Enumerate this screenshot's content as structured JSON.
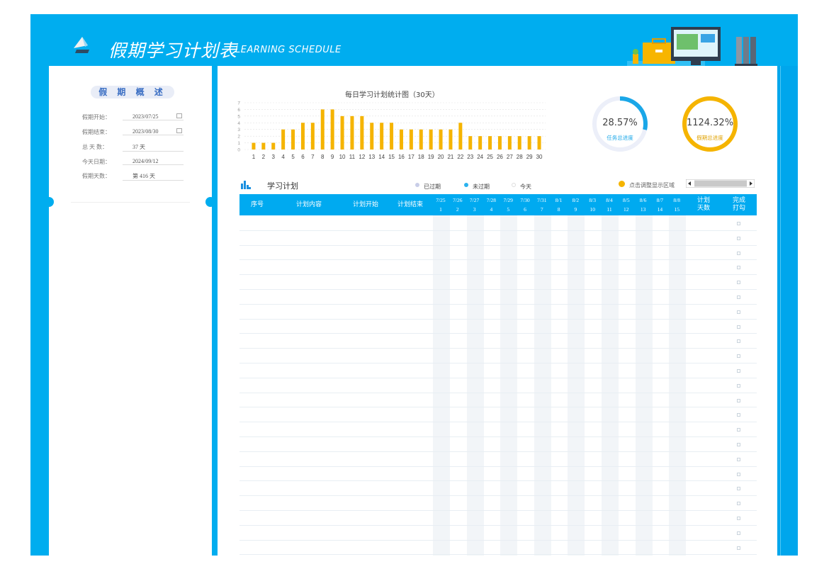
{
  "header": {
    "title": "假期学习计划表",
    "subtitle": "LEARNING SCHEDULE",
    "colors": {
      "frame": "#00adef",
      "accent_yellow": "#f5b400"
    }
  },
  "summary": {
    "section_title": "假 期 概 述",
    "fields": [
      {
        "label": "假期开始：",
        "value": "2023/07/25",
        "has_calendar": true
      },
      {
        "label": "假期结束：",
        "value": "2023/08/30",
        "has_calendar": true
      },
      {
        "label": "总 天 数：",
        "value": "37 天",
        "has_calendar": false
      },
      {
        "label": "今天日期：",
        "value": "2024/09/12",
        "has_calendar": false
      },
      {
        "label": "假期天数：",
        "value": "第 416 天",
        "has_calendar": false
      }
    ]
  },
  "chart_data": {
    "type": "bar",
    "title": "每日学习计划统计图（30天）",
    "categories": [
      "1",
      "2",
      "3",
      "4",
      "5",
      "6",
      "7",
      "8",
      "9",
      "10",
      "11",
      "12",
      "13",
      "14",
      "15",
      "16",
      "17",
      "18",
      "19",
      "20",
      "21",
      "22",
      "23",
      "24",
      "25",
      "26",
      "27",
      "28",
      "29",
      "30"
    ],
    "values": [
      1,
      1,
      1,
      3,
      3,
      4,
      4,
      6,
      6,
      5,
      5,
      5,
      4,
      4,
      4,
      3,
      3,
      3,
      3,
      3,
      3,
      4,
      2,
      2,
      2,
      2,
      2,
      2,
      2,
      2
    ],
    "ylim": [
      0,
      7
    ],
    "yticks": [
      "0",
      "1",
      "2",
      "3",
      "4",
      "5",
      "6",
      "7"
    ],
    "grid": true,
    "color": "#f5b400"
  },
  "progress": {
    "task": {
      "value": "28.57%",
      "label": "任务总进度",
      "fraction": 0.2857,
      "color": "#1aa7e8"
    },
    "holiday": {
      "value": "1124.32%",
      "label": "假期总进度",
      "fraction": 1.0,
      "color": "#f5b400"
    }
  },
  "plan": {
    "title": "学习计划",
    "legend": [
      {
        "label": "已过期",
        "color": "#c8cde8"
      },
      {
        "label": "未过期",
        "color": "#2ab2ee"
      },
      {
        "label": "今天",
        "color": "#ffffff"
      }
    ],
    "hint": "点击调整显示区域",
    "columns": {
      "index": "序号",
      "content": "计划内容",
      "start": "计划开始",
      "end": "计划结束",
      "days_line1": "计划",
      "days_line2": "天数",
      "done_line1": "完成",
      "done_line2": "打勾"
    },
    "dates": [
      {
        "date": "7/25",
        "day": "1"
      },
      {
        "date": "7/26",
        "day": "2"
      },
      {
        "date": "7/27",
        "day": "3"
      },
      {
        "date": "7/28",
        "day": "4"
      },
      {
        "date": "7/29",
        "day": "5"
      },
      {
        "date": "7/30",
        "day": "6"
      },
      {
        "date": "7/31",
        "day": "7"
      },
      {
        "date": "8/1",
        "day": "8"
      },
      {
        "date": "8/2",
        "day": "9"
      },
      {
        "date": "8/3",
        "day": "10"
      },
      {
        "date": "8/4",
        "day": "11"
      },
      {
        "date": "8/5",
        "day": "12"
      },
      {
        "date": "8/6",
        "day": "13"
      },
      {
        "date": "8/7",
        "day": "14"
      },
      {
        "date": "8/8",
        "day": "15"
      }
    ],
    "row_count": 23
  }
}
